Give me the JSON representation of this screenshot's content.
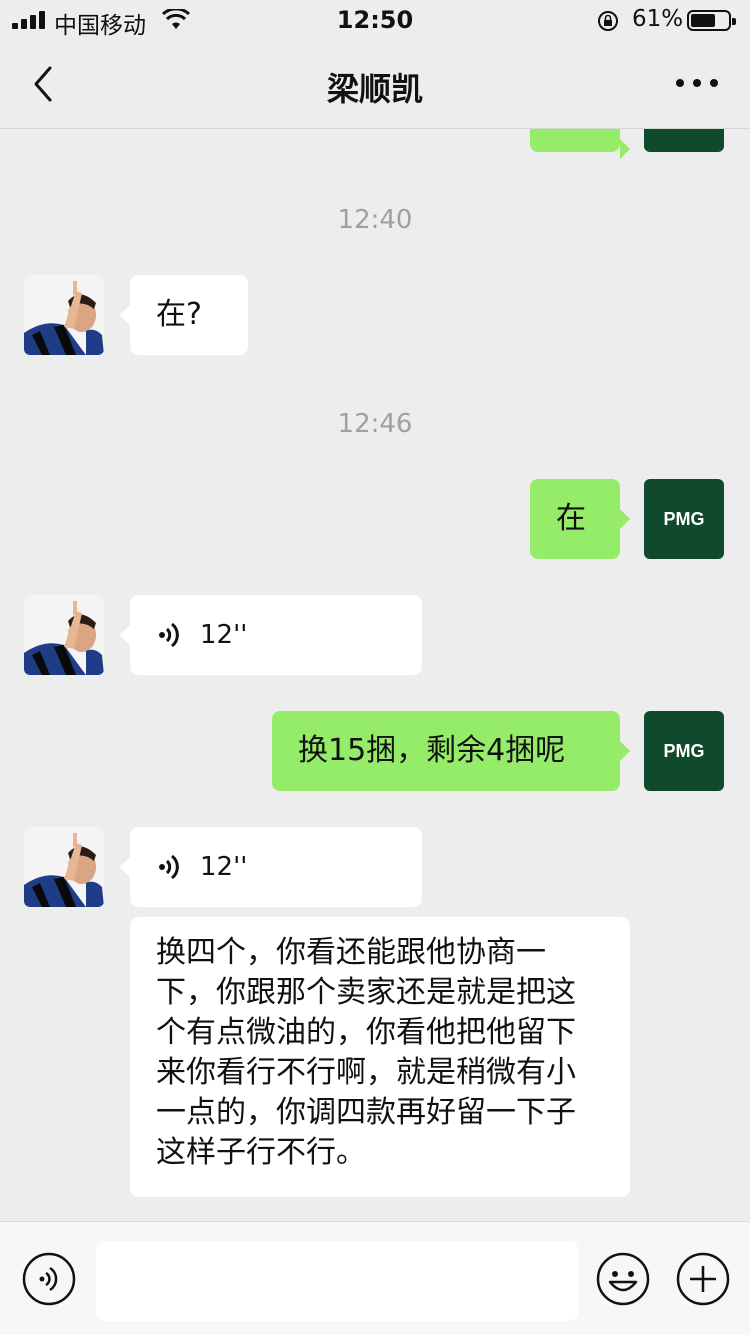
{
  "status_bar": {
    "carrier": "中国移动",
    "time": "12:50",
    "battery_percent": "61%",
    "battery_level": 0.61
  },
  "nav": {
    "title": "梁顺凯"
  },
  "messages": {
    "ts1": "12:40",
    "m1": "在?",
    "ts2": "12:46",
    "m2": "在",
    "m2_avatar": "PMG",
    "m3_len": "12''",
    "m4": "换15捆，剩余4捆呢",
    "m4_avatar": "PMG",
    "m5_len": "12''",
    "m6": "换四个，你看还能跟他协商一下，你跟那个卖家还是就是把这个有点微油的，你看他把他留下来你看行不行啊，就是稍微有小一点的，你调四款再好留一下子这样子行不行。"
  },
  "colors": {
    "outgoing_bubble": "#95ec69",
    "incoming_bubble": "#ffffff",
    "background": "#ededed",
    "pmg_avatar": "#0e4a2b"
  },
  "icons": [
    "back-icon",
    "more-icon",
    "voice-wave-icon",
    "voice-input-icon",
    "emoji-icon",
    "plus-icon"
  ]
}
